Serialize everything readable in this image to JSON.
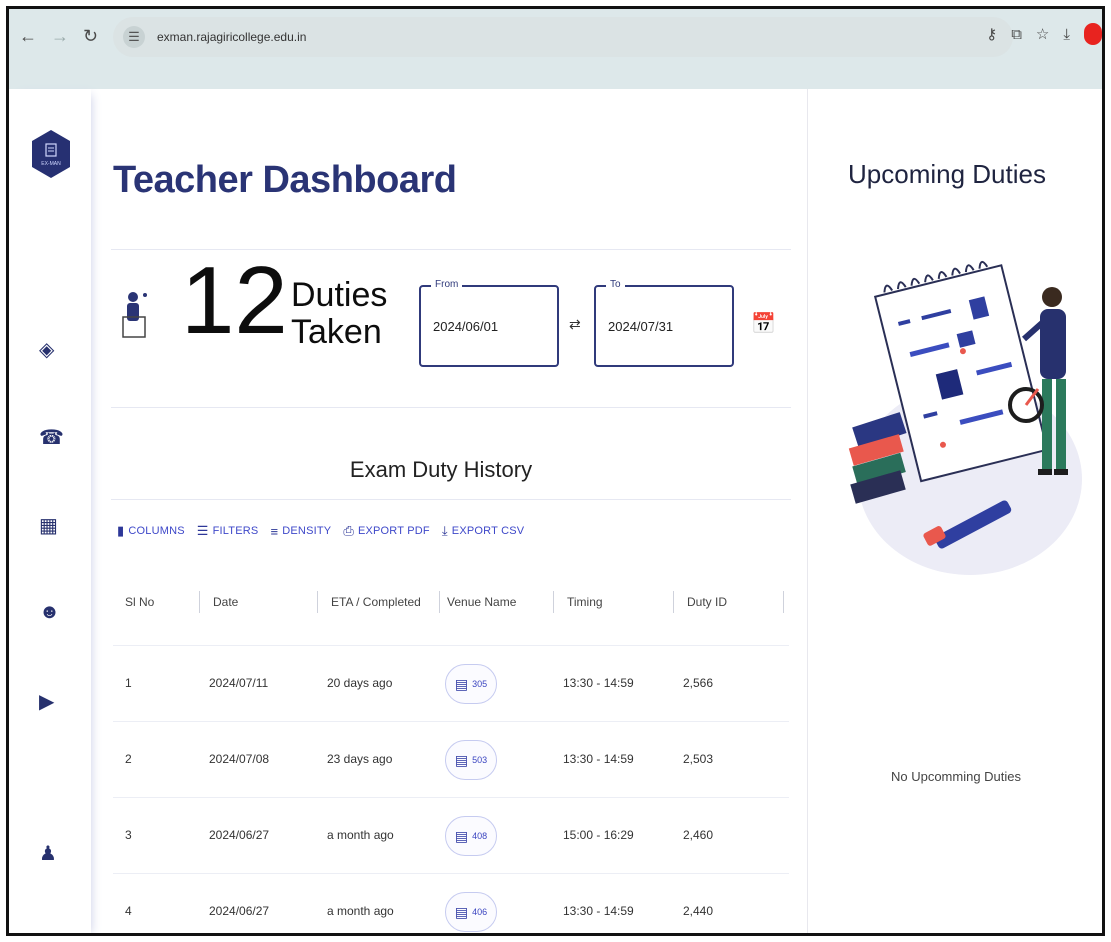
{
  "browser": {
    "back_icon": "arrow-left-icon",
    "forward_icon": "arrow-right-icon",
    "reload_icon": "reload-icon",
    "url": "exman.rajagiricollege.edu.in"
  },
  "sidebar": {
    "logo_text": "EX-MAN",
    "items": [
      {
        "icon": "layers-icon"
      },
      {
        "icon": "bell-icon"
      },
      {
        "icon": "chart-icon"
      },
      {
        "icon": "users-icon"
      },
      {
        "icon": "video-icon"
      },
      {
        "icon": "walking-person-icon"
      }
    ]
  },
  "main": {
    "title": "Teacher Dashboard",
    "duties_count": "12",
    "duties_label_1": "Duties",
    "duties_label_2": "Taken",
    "from": {
      "label": "From",
      "value": "2024/06/01"
    },
    "to": {
      "label": "To",
      "value": "2024/07/31"
    },
    "section_title": "Exam Duty History",
    "toolbar": {
      "columns": "COLUMNS",
      "filters": "FILTERS",
      "density": "DENSITY",
      "export_pdf": "EXPORT PDF",
      "export_csv": "EXPORT CSV"
    },
    "table": {
      "headers": [
        "Sl No",
        "Date",
        "ETA / Completed",
        "Venue Name",
        "Timing",
        "Duty ID"
      ],
      "rows": [
        {
          "sl": "1",
          "date": "2024/07/11",
          "eta": "20 days ago",
          "venue": "305",
          "timing": "13:30 - 14:59",
          "duty_id": "2,566"
        },
        {
          "sl": "2",
          "date": "2024/07/08",
          "eta": "23 days ago",
          "venue": "503",
          "timing": "13:30 - 14:59",
          "duty_id": "2,503"
        },
        {
          "sl": "3",
          "date": "2024/06/27",
          "eta": "a month ago",
          "venue": "408",
          "timing": "15:00 - 16:29",
          "duty_id": "2,460"
        },
        {
          "sl": "4",
          "date": "2024/06/27",
          "eta": "a month ago",
          "venue": "406",
          "timing": "13:30 - 14:59",
          "duty_id": "2,440"
        }
      ]
    }
  },
  "right_panel": {
    "title": "Upcoming Duties",
    "empty_text": "No Upcomming Duties"
  }
}
